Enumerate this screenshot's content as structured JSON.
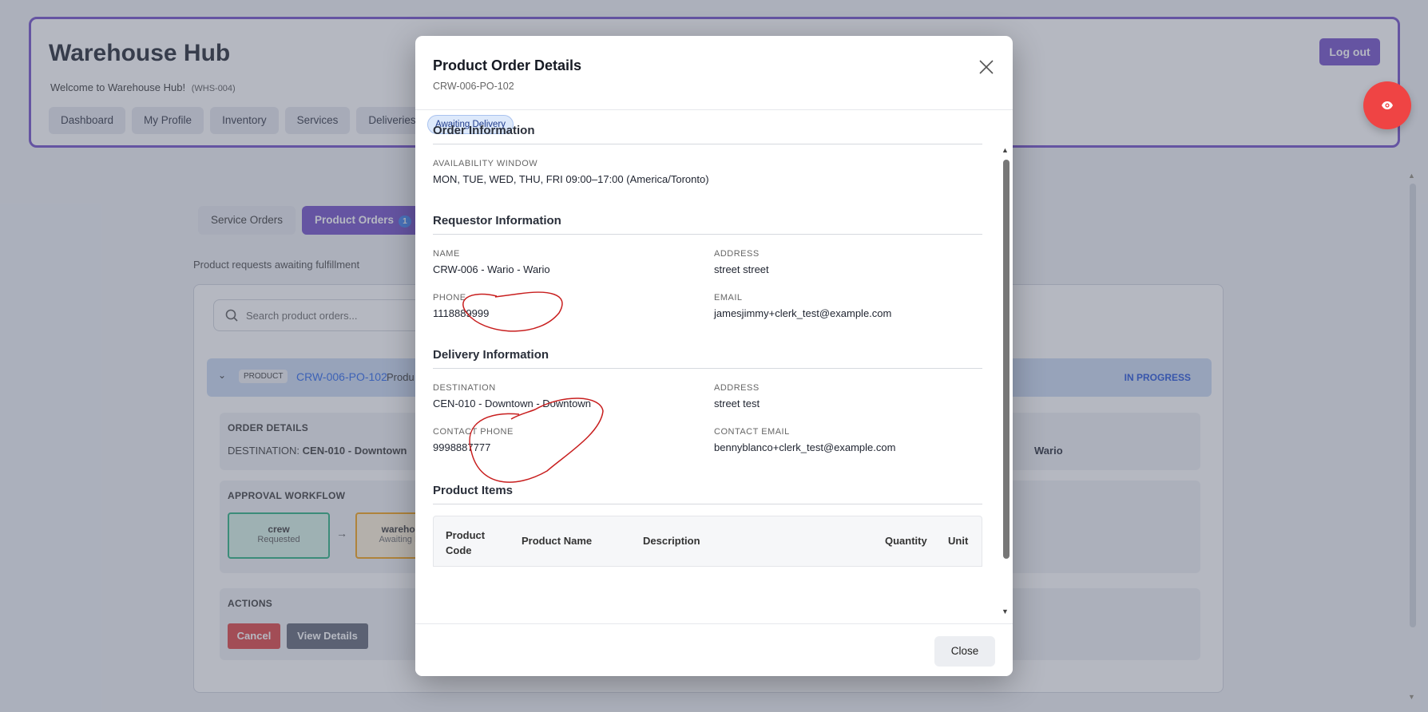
{
  "header": {
    "title": "Warehouse Hub",
    "welcome": "Welcome to Warehouse Hub!",
    "warehouse_code": "(WHS-004)",
    "logout_label": "Log out",
    "nav": [
      "Dashboard",
      "My Profile",
      "Inventory",
      "Services",
      "Deliveries"
    ]
  },
  "tabs": {
    "service_orders": "Service Orders",
    "product_orders": "Product Orders",
    "product_orders_count": "1"
  },
  "subtitle": "Product requests awaiting fulfillment",
  "search": {
    "placeholder": "Search product orders..."
  },
  "order_row": {
    "type": "PRODUCT",
    "id": "CRW-006-PO-102",
    "name_partial": "Produ",
    "status": "IN PROGRESS"
  },
  "order_details": {
    "label": "ORDER DETAILS",
    "destination_label": "DESTINATION:",
    "destination_value": "CEN-010 - Downtown",
    "right_partial": "Wario"
  },
  "workflow": {
    "label": "APPROVAL WORKFLOW",
    "steps": [
      {
        "role": "crew",
        "status": "Requested"
      },
      {
        "role": "warehouse",
        "status": "Awaiting Deliv"
      }
    ],
    "arrow": "→"
  },
  "actions": {
    "label": "ACTIONS",
    "cancel": "Cancel",
    "view_details": "View Details"
  },
  "modal": {
    "title": "Product Order Details",
    "order_id": "CRW-006-PO-102",
    "status": "Awaiting Delivery",
    "order_info": {
      "title": "Order Information",
      "availability_label": "AVAILABILITY WINDOW",
      "availability_value": "MON, TUE, WED, THU, FRI 09:00–17:00 (America/Toronto)"
    },
    "requestor": {
      "title": "Requestor Information",
      "name_label": "NAME",
      "name_value": "CRW-006 - Wario - Wario",
      "address_label": "ADDRESS",
      "address_value": "street street",
      "phone_label": "PHONE",
      "phone_value": "1118889999",
      "email_label": "EMAIL",
      "email_value": "jamesjimmy+clerk_test@example.com"
    },
    "delivery": {
      "title": "Delivery Information",
      "destination_label": "DESTINATION",
      "destination_value": "CEN-010 - Downtown - Downtown",
      "address_label": "ADDRESS",
      "address_value": "street test",
      "contact_phone_label": "CONTACT PHONE",
      "contact_phone_value": "9998887777",
      "contact_email_label": "CONTACT EMAIL",
      "contact_email_value": "bennyblanco+clerk_test@example.com"
    },
    "items": {
      "title": "Product Items",
      "columns": [
        "Product Code",
        "Product Name",
        "Description",
        "Quantity",
        "Unit"
      ]
    },
    "close_label": "Close"
  },
  "colors": {
    "accent": "#6d4ac7",
    "fab": "#ef4444",
    "annotation": "#c81e1e",
    "link": "#2563eb"
  },
  "icons": [
    "eye-icon",
    "search-icon",
    "close-icon",
    "chevron-down-icon"
  ]
}
